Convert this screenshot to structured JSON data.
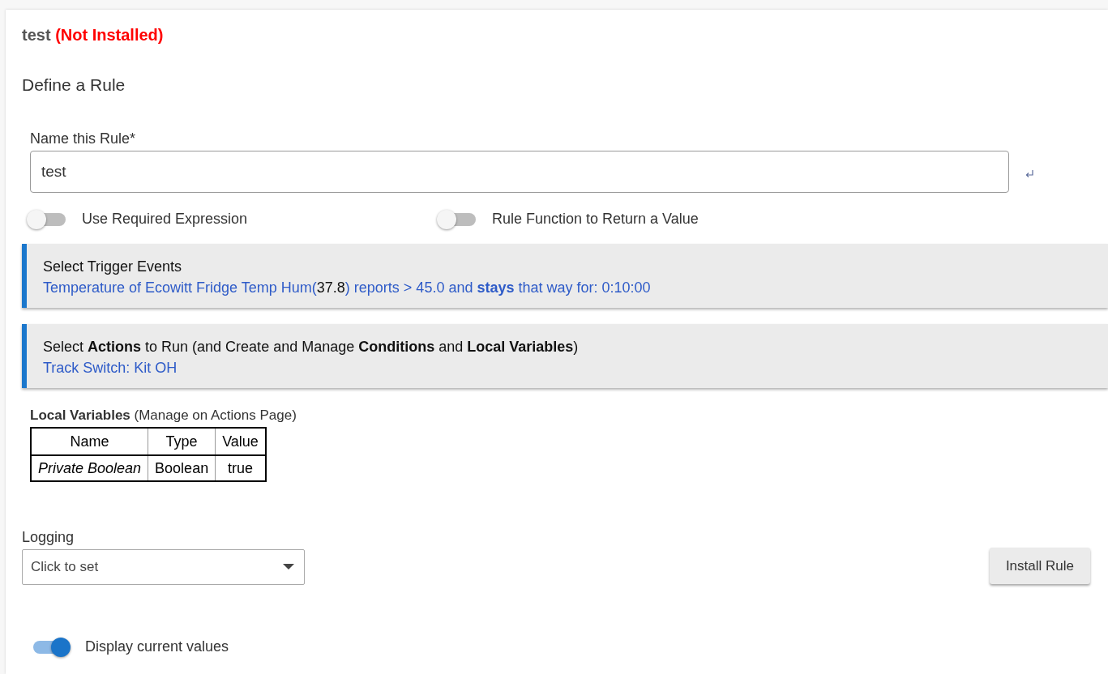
{
  "header": {
    "name": "test",
    "status": "(Not Installed)"
  },
  "section_title": "Define a Rule",
  "name_field": {
    "label": "Name this Rule*",
    "value": "test"
  },
  "toggles": [
    {
      "label": "Use Required Expression",
      "on": false
    },
    {
      "label": "Rule Function to Return a Value",
      "on": false
    }
  ],
  "panels": [
    {
      "title": "Select Trigger Events",
      "summary": [
        {
          "kind": "link",
          "text": "Temperature of Ecowitt Fridge Temp Hum("
        },
        {
          "kind": "value",
          "text": "37.8"
        },
        {
          "kind": "link",
          "text": ") reports > 45.0 and **stays** that way for: 0:10:00"
        }
      ]
    },
    {
      "title": "Select **Actions** to Run (and Create and Manage **Conditions** and **Local Variables**)",
      "summary": [
        {
          "kind": "link",
          "text": "Track Switch: Kit OH"
        }
      ]
    }
  ],
  "local_variables": {
    "title": "**Local Variables** (Manage on Actions Page)",
    "columns": [
      "Name",
      "Type",
      "Value"
    ],
    "rows": [
      [
        "Private Boolean",
        "Boolean",
        "true"
      ]
    ]
  },
  "logging": {
    "label": "Logging",
    "placeholder": "Click to set"
  },
  "install_button": "Install Rule",
  "display_toggle": {
    "label": "Display current values",
    "on": true
  }
}
